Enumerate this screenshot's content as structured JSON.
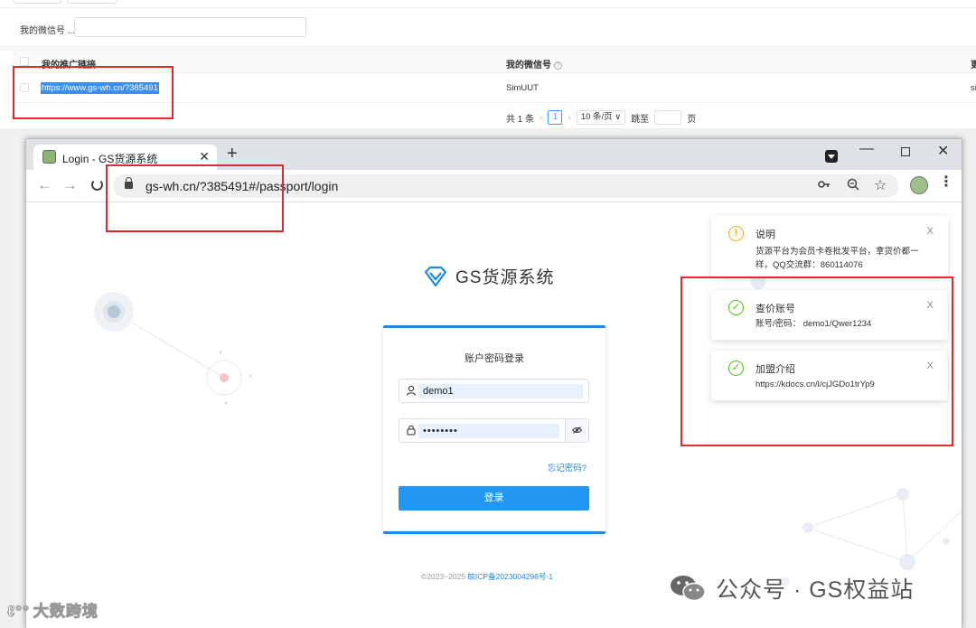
{
  "background_admin": {
    "filter_label": "我的微信号 ...",
    "table": {
      "headers": [
        "我的推广链接",
        "我的微信号",
        "更"
      ],
      "row": {
        "link": "https://www.gs-wh.cn/?385491",
        "wechat": "SimUUT",
        "extra": "si"
      }
    },
    "pager": {
      "total": "共 1 条",
      "prev": "‹",
      "page": "1",
      "next": "›",
      "page_size": "10 条/页 ∨",
      "jump_label": "跳至",
      "page_suffix": "页"
    }
  },
  "browser": {
    "tab_title": "Login - GS货源系统",
    "tab_close": "✕",
    "new_tab": "+",
    "window_min": "—",
    "window_close": "✕",
    "url": "gs-wh.cn/?385491#/passport/login",
    "icons": [
      "back-icon",
      "forward-icon",
      "reload-icon",
      "lock-icon",
      "key-icon",
      "zoom-icon",
      "star-icon",
      "profile-icon",
      "menu-icon"
    ]
  },
  "login_page": {
    "brand": "GS货源系统",
    "card_title": "账户密码登录",
    "username": "demo1",
    "password_mask": "••••••••",
    "forgot": "忘记密码?",
    "login_button": "登录",
    "footer_copy": "©2023~2025 ",
    "footer_icp": "皖ICP备2023004296号-1"
  },
  "notifications": [
    {
      "icon": "warning-icon",
      "title": "说明",
      "body": "货源平台为会员卡卷批发平台，拿货价都一样，QQ交流群：860114076"
    },
    {
      "icon": "check-circle-icon",
      "title": "查价账号",
      "body": "账号/密码： demo1/Qwer1234"
    },
    {
      "icon": "check-circle-icon",
      "title": "加盟介绍",
      "body": "https://kdocs.cn/l/cjJGDo1trYp9"
    }
  ],
  "watermarks": {
    "left": "大数跨境",
    "right": "公众号 · GS权益站"
  },
  "colors": {
    "accent": "#1e88e5",
    "annotation_red": "#e02b2b",
    "warning": "#faad14",
    "success": "#52c41a"
  }
}
